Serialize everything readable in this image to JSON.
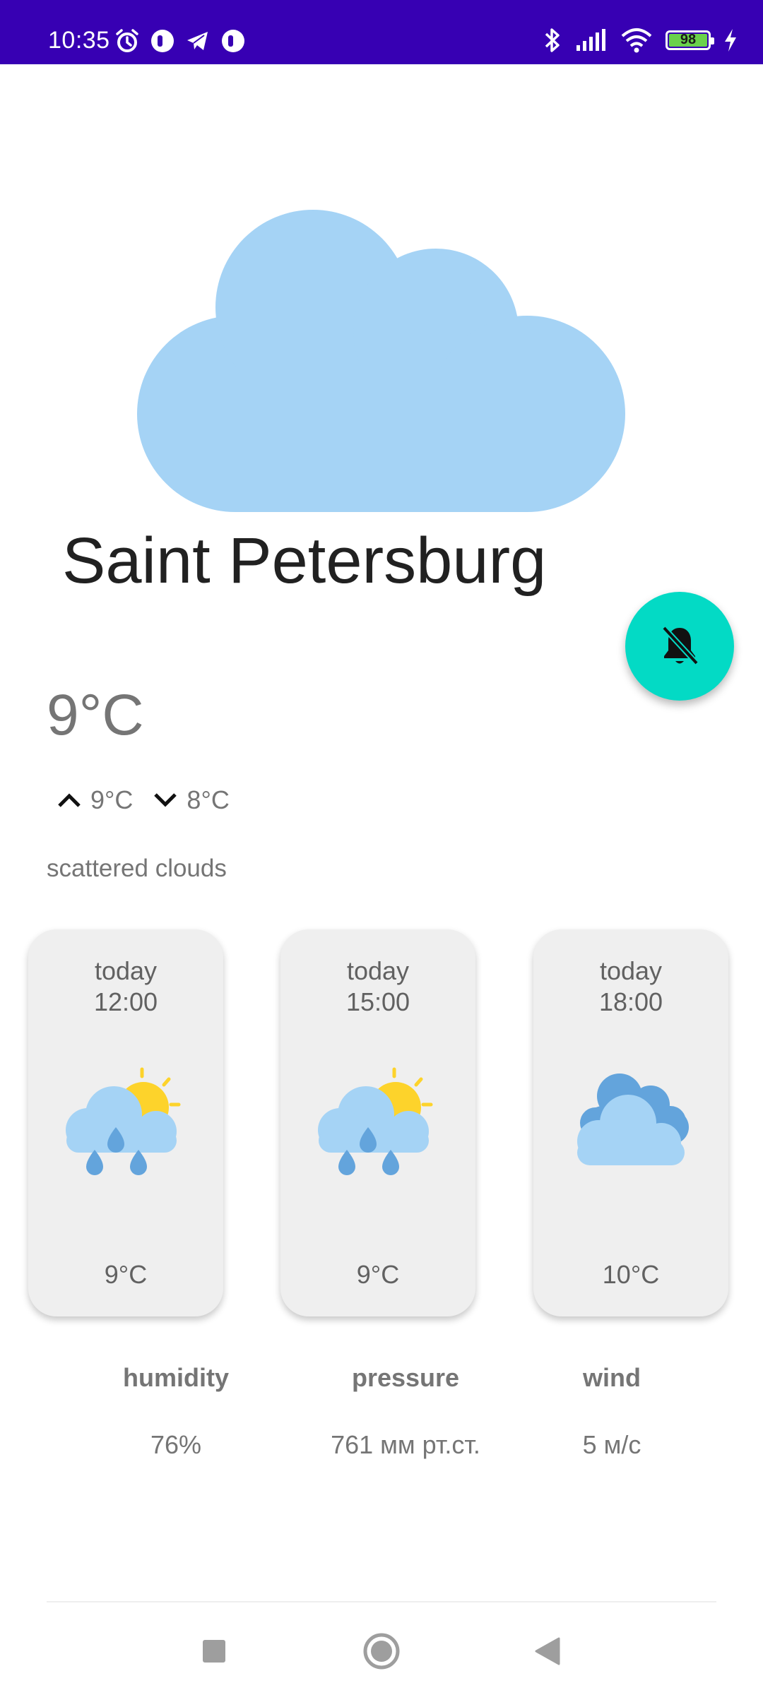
{
  "status_bar": {
    "time": "10:35",
    "battery_percent": "98",
    "battery_level": 0.98,
    "left_icons": [
      "alarm-icon",
      "app-notification-icon",
      "telegram-icon",
      "app-notification-icon"
    ],
    "right_icons": [
      "bluetooth-icon",
      "signal-icon",
      "wifi-icon",
      "battery-icon",
      "charging-icon"
    ]
  },
  "weather": {
    "city": "Saint Petersburg",
    "current_temp": "9°C",
    "max_temp": "9°C",
    "min_temp": "8°C",
    "description": "scattered clouds",
    "main_icon": "cloud-icon"
  },
  "forecast": [
    {
      "day": "today",
      "time": "12:00",
      "temp": "9°C",
      "icon": "rain-sun-icon"
    },
    {
      "day": "today",
      "time": "15:00",
      "temp": "9°C",
      "icon": "rain-sun-icon"
    },
    {
      "day": "today",
      "time": "18:00",
      "temp": "10°C",
      "icon": "clouds-icon"
    }
  ],
  "details": {
    "humidity_label": "humidity",
    "humidity_value": "76%",
    "pressure_label": "pressure",
    "pressure_value": "761 мм рт.ст.",
    "wind_label": "wind",
    "wind_value": "5 м/с"
  },
  "fab": {
    "icon": "notifications-off-icon"
  },
  "navigation": {
    "icons": [
      "recents-icon",
      "home-icon",
      "back-icon"
    ]
  },
  "colors": {
    "status_bar": "#3700b3",
    "fab": "#03dac5",
    "cloud_light": "#a5d3f5",
    "cloud_dark": "#63a4dc",
    "sun": "#fdd32b",
    "card_bg": "#efefef"
  }
}
